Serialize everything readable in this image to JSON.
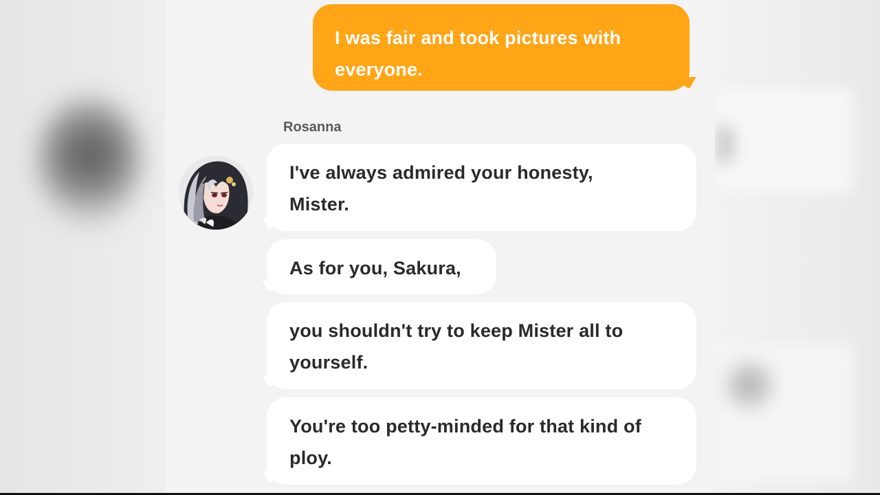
{
  "chat": {
    "messages": [
      {
        "from": "user",
        "lines": [
          "I was fair and took pictures with",
          "everyone."
        ]
      }
    ],
    "sender_name": "Rosanna",
    "replies": [
      {
        "lines": [
          "I've always admired your honesty,",
          "Mister."
        ]
      },
      {
        "lines": [
          "As for you, Sakura,"
        ]
      },
      {
        "lines": [
          "you shouldn't try to keep Mister all to",
          "yourself."
        ]
      },
      {
        "lines": [
          "You're too petty-minded for that kind of",
          "ploy."
        ]
      }
    ]
  },
  "colors": {
    "user_bubble": "#ffa516",
    "reply_bubble": "#ffffff",
    "reply_text": "#2a2a2a",
    "background": "#f3f3f3"
  },
  "icons": {
    "avatar": "character-portrait"
  }
}
